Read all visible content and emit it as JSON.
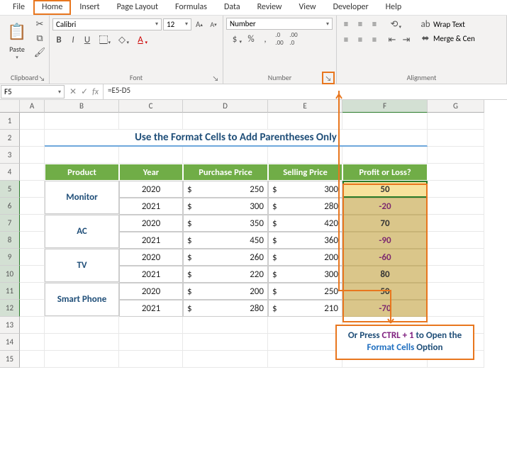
{
  "menu": {
    "items": [
      "File",
      "Home",
      "Insert",
      "Page Layout",
      "Formulas",
      "Data",
      "Review",
      "View",
      "Developer",
      "Help"
    ],
    "active": "Home"
  },
  "ribbon": {
    "clipboard": {
      "label": "Clipboard",
      "paste": "Paste"
    },
    "font": {
      "label": "Font",
      "name": "Calibri",
      "size": "12",
      "bold": "B",
      "italic": "I",
      "underline": "U"
    },
    "number": {
      "label": "Number",
      "format": "Number",
      "currency": "$",
      "percent": "%",
      "comma": ",",
      "inc": ".0",
      "dec": ".00"
    },
    "alignment": {
      "label": "Alignment",
      "wrap": "Wrap Text",
      "merge": "Merge & Cen"
    }
  },
  "namebox": "F5",
  "formula": "=E5-D5",
  "fx_label": "fx",
  "cols": [
    "A",
    "B",
    "C",
    "D",
    "E",
    "F",
    "G"
  ],
  "title": "Use the Format Cells to Add Parentheses Only",
  "headers": [
    "Product",
    "Year",
    "Purchase Price",
    "Selling Price",
    "Profit or Loss?"
  ],
  "rows": [
    {
      "product": "Monitor",
      "span": 2,
      "year": "2020",
      "pp": "250",
      "sp": "300",
      "pl": "50",
      "neg": false
    },
    {
      "product": "",
      "year": "2021",
      "pp": "300",
      "sp": "280",
      "pl": "-20",
      "neg": true
    },
    {
      "product": "AC",
      "span": 2,
      "year": "2020",
      "pp": "350",
      "sp": "420",
      "pl": "70",
      "neg": false
    },
    {
      "product": "",
      "year": "2021",
      "pp": "450",
      "sp": "360",
      "pl": "-90",
      "neg": true
    },
    {
      "product": "TV",
      "span": 2,
      "year": "2020",
      "pp": "260",
      "sp": "200",
      "pl": "-60",
      "neg": true
    },
    {
      "product": "",
      "year": "2021",
      "pp": "220",
      "sp": "300",
      "pl": "80",
      "neg": false
    },
    {
      "product": "Smart Phone",
      "span": 2,
      "year": "2020",
      "pp": "200",
      "sp": "250",
      "pl": "50",
      "neg": false
    },
    {
      "product": "",
      "year": "2021",
      "pp": "280",
      "sp": "210",
      "pl": "-70",
      "neg": true
    }
  ],
  "annotation": {
    "pre": "Or Press ",
    "key": "CTRL + 1",
    "mid": " to Open the ",
    "link": "Format Cells",
    "post": " Option"
  }
}
